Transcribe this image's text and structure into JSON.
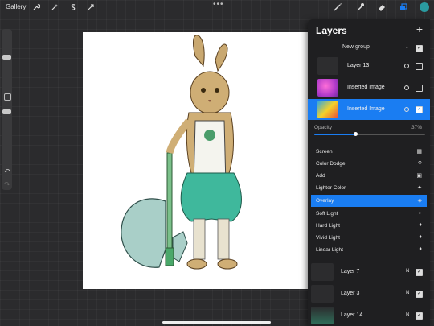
{
  "topbar": {
    "gallery_label": "Gallery",
    "tools_left": [
      "wrench-icon",
      "magic-wand-icon",
      "selection-icon",
      "transform-arrow-icon"
    ],
    "tools_right": [
      "brush-icon",
      "smudge-icon",
      "eraser-icon",
      "layers-icon"
    ],
    "more": "•••",
    "accent": "#1a7df2"
  },
  "layers_panel": {
    "title": "Layers",
    "add_label": "+",
    "group_name": "New group",
    "layers": [
      {
        "name": "Layer 13",
        "visible": false
      },
      {
        "name": "Inserted Image",
        "visible": false
      },
      {
        "name": "Inserted Image",
        "visible": true,
        "selected": true
      }
    ],
    "opacity_label": "Opacity",
    "opacity_value": "37%",
    "opacity_fraction": 0.37,
    "blend_modes": [
      {
        "name": "Screen",
        "icon": "screen-icon"
      },
      {
        "name": "Color Dodge",
        "icon": "color-dodge-icon"
      },
      {
        "name": "Add",
        "icon": "add-icon"
      },
      {
        "name": "Lighter Color",
        "icon": "lighter-color-icon"
      },
      {
        "name": "Overlay",
        "icon": "overlay-icon",
        "selected": true
      },
      {
        "name": "Soft Light",
        "icon": "soft-light-icon"
      },
      {
        "name": "Hard Light",
        "icon": "hard-light-icon"
      },
      {
        "name": "Vivid Light",
        "icon": "vivid-light-icon"
      },
      {
        "name": "Linear Light",
        "icon": "linear-light-icon"
      }
    ],
    "bottom_layers": [
      {
        "name": "Layer 7",
        "mode": "N"
      },
      {
        "name": "Layer 3",
        "mode": "N"
      },
      {
        "name": "Layer 14",
        "mode": "N"
      }
    ]
  }
}
